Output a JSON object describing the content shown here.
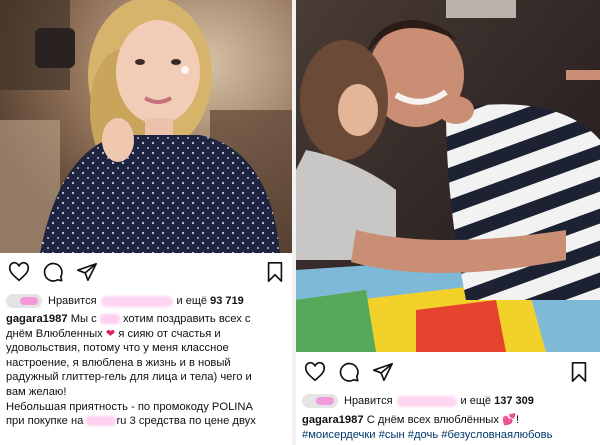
{
  "left_post": {
    "likes_prefix": "Нравится",
    "likes_suffix": "и ещё",
    "likes_count": "93 719",
    "username": "gagara1987",
    "caption_lines": [
      [
        "Мы с ",
        "",
        " хотим поздравить всех с"
      ],
      [
        "днём Влюбленных ",
        "❤",
        " я сияю от счастья и"
      ],
      [
        "удовольствия, потому что у меня классное"
      ],
      [
        "настроение, я влюблена в жизнь и в новый"
      ],
      [
        "радужный глиттер-гель для лица и тела) чего и"
      ],
      [
        "вам желаю!"
      ],
      [
        "Небольшая приятность - по промокоду POLINA"
      ],
      [
        "при покупке на ",
        "",
        "ru 3 средства по цене двух"
      ]
    ]
  },
  "right_post": {
    "likes_prefix": "Нравится",
    "likes_suffix": "и ещё",
    "likes_count": "137 309",
    "username": "gagara1987",
    "caption_text": "С днём всех влюблённых",
    "caption_emoji": "💕",
    "caption_end": "!",
    "hashtags": "#моисердечки #сын #дочь #безусловнаялюбовь"
  },
  "icons": {
    "like": "heart-icon",
    "comment": "comment-icon",
    "share": "paper-plane-icon",
    "save": "bookmark-icon"
  },
  "colors": {
    "hashtag": "#00376b",
    "heart": "#e0245e"
  }
}
